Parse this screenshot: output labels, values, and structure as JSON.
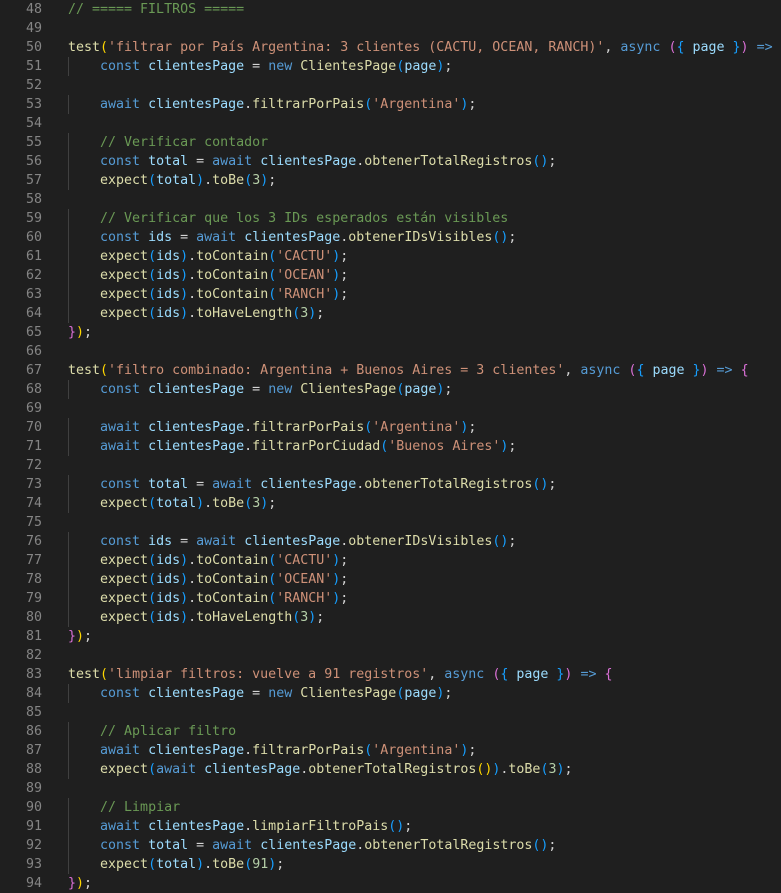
{
  "editor": {
    "first_line_number": 48,
    "lines": [
      [
        [
          "c",
          "// ===== FILTROS ====="
        ]
      ],
      [],
      [
        [
          "f",
          "test"
        ],
        [
          "b1",
          "("
        ],
        [
          "s",
          "'filtrar por País Argentina: 3 clientes (CACTU, OCEAN, RANCH)'"
        ],
        [
          "p",
          ", "
        ],
        [
          "k",
          "async"
        ],
        [
          "p",
          " "
        ],
        [
          "b2",
          "("
        ],
        [
          "b3",
          "{"
        ],
        [
          "v",
          " page "
        ],
        [
          "b3",
          "}"
        ],
        [
          "b2",
          ")"
        ],
        [
          "p",
          " "
        ],
        [
          "k",
          "=>"
        ],
        [
          "p",
          " "
        ],
        [
          "b2",
          "{"
        ]
      ],
      [
        [
          "p",
          "    "
        ],
        [
          "k",
          "const"
        ],
        [
          "p",
          " "
        ],
        [
          "v",
          "clientesPage"
        ],
        [
          "p",
          " = "
        ],
        [
          "k",
          "new"
        ],
        [
          "p",
          " "
        ],
        [
          "f",
          "ClientesPage"
        ],
        [
          "b3",
          "("
        ],
        [
          "v",
          "page"
        ],
        [
          "b3",
          ")"
        ],
        [
          "p",
          ";"
        ]
      ],
      [],
      [
        [
          "p",
          "    "
        ],
        [
          "k",
          "await"
        ],
        [
          "p",
          " "
        ],
        [
          "v",
          "clientesPage"
        ],
        [
          "p",
          "."
        ],
        [
          "f",
          "filtrarPorPais"
        ],
        [
          "b3",
          "("
        ],
        [
          "s",
          "'Argentina'"
        ],
        [
          "b3",
          ")"
        ],
        [
          "p",
          ";"
        ]
      ],
      [],
      [
        [
          "p",
          "    "
        ],
        [
          "c",
          "// Verificar contador"
        ]
      ],
      [
        [
          "p",
          "    "
        ],
        [
          "k",
          "const"
        ],
        [
          "p",
          " "
        ],
        [
          "v",
          "total"
        ],
        [
          "p",
          " = "
        ],
        [
          "k",
          "await"
        ],
        [
          "p",
          " "
        ],
        [
          "v",
          "clientesPage"
        ],
        [
          "p",
          "."
        ],
        [
          "f",
          "obtenerTotalRegistros"
        ],
        [
          "b3",
          "()"
        ],
        [
          "p",
          ";"
        ]
      ],
      [
        [
          "p",
          "    "
        ],
        [
          "f",
          "expect"
        ],
        [
          "b3",
          "("
        ],
        [
          "v",
          "total"
        ],
        [
          "b3",
          ")"
        ],
        [
          "p",
          "."
        ],
        [
          "f",
          "toBe"
        ],
        [
          "b3",
          "("
        ],
        [
          "n",
          "3"
        ],
        [
          "b3",
          ")"
        ],
        [
          "p",
          ";"
        ]
      ],
      [],
      [
        [
          "p",
          "    "
        ],
        [
          "c",
          "// Verificar que los 3 IDs esperados están visibles"
        ]
      ],
      [
        [
          "p",
          "    "
        ],
        [
          "k",
          "const"
        ],
        [
          "p",
          " "
        ],
        [
          "v",
          "ids"
        ],
        [
          "p",
          " = "
        ],
        [
          "k",
          "await"
        ],
        [
          "p",
          " "
        ],
        [
          "v",
          "clientesPage"
        ],
        [
          "p",
          "."
        ],
        [
          "f",
          "obtenerIDsVisibles"
        ],
        [
          "b3",
          "()"
        ],
        [
          "p",
          ";"
        ]
      ],
      [
        [
          "p",
          "    "
        ],
        [
          "f",
          "expect"
        ],
        [
          "b3",
          "("
        ],
        [
          "v",
          "ids"
        ],
        [
          "b3",
          ")"
        ],
        [
          "p",
          "."
        ],
        [
          "f",
          "toContain"
        ],
        [
          "b3",
          "("
        ],
        [
          "s",
          "'CACTU'"
        ],
        [
          "b3",
          ")"
        ],
        [
          "p",
          ";"
        ]
      ],
      [
        [
          "p",
          "    "
        ],
        [
          "f",
          "expect"
        ],
        [
          "b3",
          "("
        ],
        [
          "v",
          "ids"
        ],
        [
          "b3",
          ")"
        ],
        [
          "p",
          "."
        ],
        [
          "f",
          "toContain"
        ],
        [
          "b3",
          "("
        ],
        [
          "s",
          "'OCEAN'"
        ],
        [
          "b3",
          ")"
        ],
        [
          "p",
          ";"
        ]
      ],
      [
        [
          "p",
          "    "
        ],
        [
          "f",
          "expect"
        ],
        [
          "b3",
          "("
        ],
        [
          "v",
          "ids"
        ],
        [
          "b3",
          ")"
        ],
        [
          "p",
          "."
        ],
        [
          "f",
          "toContain"
        ],
        [
          "b3",
          "("
        ],
        [
          "s",
          "'RANCH'"
        ],
        [
          "b3",
          ")"
        ],
        [
          "p",
          ";"
        ]
      ],
      [
        [
          "p",
          "    "
        ],
        [
          "f",
          "expect"
        ],
        [
          "b3",
          "("
        ],
        [
          "v",
          "ids"
        ],
        [
          "b3",
          ")"
        ],
        [
          "p",
          "."
        ],
        [
          "f",
          "toHaveLength"
        ],
        [
          "b3",
          "("
        ],
        [
          "n",
          "3"
        ],
        [
          "b3",
          ")"
        ],
        [
          "p",
          ";"
        ]
      ],
      [
        [
          "b2",
          "}"
        ],
        [
          "b1",
          ")"
        ],
        [
          "p",
          ";"
        ]
      ],
      [],
      [
        [
          "f",
          "test"
        ],
        [
          "b1",
          "("
        ],
        [
          "s",
          "'filtro combinado: Argentina + Buenos Aires = 3 clientes'"
        ],
        [
          "p",
          ", "
        ],
        [
          "k",
          "async"
        ],
        [
          "p",
          " "
        ],
        [
          "b2",
          "("
        ],
        [
          "b3",
          "{"
        ],
        [
          "v",
          " page "
        ],
        [
          "b3",
          "}"
        ],
        [
          "b2",
          ")"
        ],
        [
          "p",
          " "
        ],
        [
          "k",
          "=>"
        ],
        [
          "p",
          " "
        ],
        [
          "b2",
          "{"
        ]
      ],
      [
        [
          "p",
          "    "
        ],
        [
          "k",
          "const"
        ],
        [
          "p",
          " "
        ],
        [
          "v",
          "clientesPage"
        ],
        [
          "p",
          " = "
        ],
        [
          "k",
          "new"
        ],
        [
          "p",
          " "
        ],
        [
          "f",
          "ClientesPage"
        ],
        [
          "b3",
          "("
        ],
        [
          "v",
          "page"
        ],
        [
          "b3",
          ")"
        ],
        [
          "p",
          ";"
        ]
      ],
      [],
      [
        [
          "p",
          "    "
        ],
        [
          "k",
          "await"
        ],
        [
          "p",
          " "
        ],
        [
          "v",
          "clientesPage"
        ],
        [
          "p",
          "."
        ],
        [
          "f",
          "filtrarPorPais"
        ],
        [
          "b3",
          "("
        ],
        [
          "s",
          "'Argentina'"
        ],
        [
          "b3",
          ")"
        ],
        [
          "p",
          ";"
        ]
      ],
      [
        [
          "p",
          "    "
        ],
        [
          "k",
          "await"
        ],
        [
          "p",
          " "
        ],
        [
          "v",
          "clientesPage"
        ],
        [
          "p",
          "."
        ],
        [
          "f",
          "filtrarPorCiudad"
        ],
        [
          "b3",
          "("
        ],
        [
          "s",
          "'Buenos Aires'"
        ],
        [
          "b3",
          ")"
        ],
        [
          "p",
          ";"
        ]
      ],
      [],
      [
        [
          "p",
          "    "
        ],
        [
          "k",
          "const"
        ],
        [
          "p",
          " "
        ],
        [
          "v",
          "total"
        ],
        [
          "p",
          " = "
        ],
        [
          "k",
          "await"
        ],
        [
          "p",
          " "
        ],
        [
          "v",
          "clientesPage"
        ],
        [
          "p",
          "."
        ],
        [
          "f",
          "obtenerTotalRegistros"
        ],
        [
          "b3",
          "()"
        ],
        [
          "p",
          ";"
        ]
      ],
      [
        [
          "p",
          "    "
        ],
        [
          "f",
          "expect"
        ],
        [
          "b3",
          "("
        ],
        [
          "v",
          "total"
        ],
        [
          "b3",
          ")"
        ],
        [
          "p",
          "."
        ],
        [
          "f",
          "toBe"
        ],
        [
          "b3",
          "("
        ],
        [
          "n",
          "3"
        ],
        [
          "b3",
          ")"
        ],
        [
          "p",
          ";"
        ]
      ],
      [],
      [
        [
          "p",
          "    "
        ],
        [
          "k",
          "const"
        ],
        [
          "p",
          " "
        ],
        [
          "v",
          "ids"
        ],
        [
          "p",
          " = "
        ],
        [
          "k",
          "await"
        ],
        [
          "p",
          " "
        ],
        [
          "v",
          "clientesPage"
        ],
        [
          "p",
          "."
        ],
        [
          "f",
          "obtenerIDsVisibles"
        ],
        [
          "b3",
          "()"
        ],
        [
          "p",
          ";"
        ]
      ],
      [
        [
          "p",
          "    "
        ],
        [
          "f",
          "expect"
        ],
        [
          "b3",
          "("
        ],
        [
          "v",
          "ids"
        ],
        [
          "b3",
          ")"
        ],
        [
          "p",
          "."
        ],
        [
          "f",
          "toContain"
        ],
        [
          "b3",
          "("
        ],
        [
          "s",
          "'CACTU'"
        ],
        [
          "b3",
          ")"
        ],
        [
          "p",
          ";"
        ]
      ],
      [
        [
          "p",
          "    "
        ],
        [
          "f",
          "expect"
        ],
        [
          "b3",
          "("
        ],
        [
          "v",
          "ids"
        ],
        [
          "b3",
          ")"
        ],
        [
          "p",
          "."
        ],
        [
          "f",
          "toContain"
        ],
        [
          "b3",
          "("
        ],
        [
          "s",
          "'OCEAN'"
        ],
        [
          "b3",
          ")"
        ],
        [
          "p",
          ";"
        ]
      ],
      [
        [
          "p",
          "    "
        ],
        [
          "f",
          "expect"
        ],
        [
          "b3",
          "("
        ],
        [
          "v",
          "ids"
        ],
        [
          "b3",
          ")"
        ],
        [
          "p",
          "."
        ],
        [
          "f",
          "toContain"
        ],
        [
          "b3",
          "("
        ],
        [
          "s",
          "'RANCH'"
        ],
        [
          "b3",
          ")"
        ],
        [
          "p",
          ";"
        ]
      ],
      [
        [
          "p",
          "    "
        ],
        [
          "f",
          "expect"
        ],
        [
          "b3",
          "("
        ],
        [
          "v",
          "ids"
        ],
        [
          "b3",
          ")"
        ],
        [
          "p",
          "."
        ],
        [
          "f",
          "toHaveLength"
        ],
        [
          "b3",
          "("
        ],
        [
          "n",
          "3"
        ],
        [
          "b3",
          ")"
        ],
        [
          "p",
          ";"
        ]
      ],
      [
        [
          "b2",
          "}"
        ],
        [
          "b1",
          ")"
        ],
        [
          "p",
          ";"
        ]
      ],
      [],
      [
        [
          "f",
          "test"
        ],
        [
          "b1",
          "("
        ],
        [
          "s",
          "'limpiar filtros: vuelve a 91 registros'"
        ],
        [
          "p",
          ", "
        ],
        [
          "k",
          "async"
        ],
        [
          "p",
          " "
        ],
        [
          "b2",
          "("
        ],
        [
          "b3",
          "{"
        ],
        [
          "v",
          " page "
        ],
        [
          "b3",
          "}"
        ],
        [
          "b2",
          ")"
        ],
        [
          "p",
          " "
        ],
        [
          "k",
          "=>"
        ],
        [
          "p",
          " "
        ],
        [
          "b2",
          "{"
        ]
      ],
      [
        [
          "p",
          "    "
        ],
        [
          "k",
          "const"
        ],
        [
          "p",
          " "
        ],
        [
          "v",
          "clientesPage"
        ],
        [
          "p",
          " = "
        ],
        [
          "k",
          "new"
        ],
        [
          "p",
          " "
        ],
        [
          "f",
          "ClientesPage"
        ],
        [
          "b3",
          "("
        ],
        [
          "v",
          "page"
        ],
        [
          "b3",
          ")"
        ],
        [
          "p",
          ";"
        ]
      ],
      [],
      [
        [
          "p",
          "    "
        ],
        [
          "c",
          "// Aplicar filtro"
        ]
      ],
      [
        [
          "p",
          "    "
        ],
        [
          "k",
          "await"
        ],
        [
          "p",
          " "
        ],
        [
          "v",
          "clientesPage"
        ],
        [
          "p",
          "."
        ],
        [
          "f",
          "filtrarPorPais"
        ],
        [
          "b3",
          "("
        ],
        [
          "s",
          "'Argentina'"
        ],
        [
          "b3",
          ")"
        ],
        [
          "p",
          ";"
        ]
      ],
      [
        [
          "p",
          "    "
        ],
        [
          "f",
          "expect"
        ],
        [
          "b3",
          "("
        ],
        [
          "k",
          "await"
        ],
        [
          "p",
          " "
        ],
        [
          "v",
          "clientesPage"
        ],
        [
          "p",
          "."
        ],
        [
          "f",
          "obtenerTotalRegistros"
        ],
        [
          "b1",
          "()"
        ],
        [
          "b3",
          ")"
        ],
        [
          "p",
          "."
        ],
        [
          "f",
          "toBe"
        ],
        [
          "b3",
          "("
        ],
        [
          "n",
          "3"
        ],
        [
          "b3",
          ")"
        ],
        [
          "p",
          ";"
        ]
      ],
      [],
      [
        [
          "p",
          "    "
        ],
        [
          "c",
          "// Limpiar"
        ]
      ],
      [
        [
          "p",
          "    "
        ],
        [
          "k",
          "await"
        ],
        [
          "p",
          " "
        ],
        [
          "v",
          "clientesPage"
        ],
        [
          "p",
          "."
        ],
        [
          "f",
          "limpiarFiltroPais"
        ],
        [
          "b3",
          "()"
        ],
        [
          "p",
          ";"
        ]
      ],
      [
        [
          "p",
          "    "
        ],
        [
          "k",
          "const"
        ],
        [
          "p",
          " "
        ],
        [
          "v",
          "total"
        ],
        [
          "p",
          " = "
        ],
        [
          "k",
          "await"
        ],
        [
          "p",
          " "
        ],
        [
          "v",
          "clientesPage"
        ],
        [
          "p",
          "."
        ],
        [
          "f",
          "obtenerTotalRegistros"
        ],
        [
          "b3",
          "()"
        ],
        [
          "p",
          ";"
        ]
      ],
      [
        [
          "p",
          "    "
        ],
        [
          "f",
          "expect"
        ],
        [
          "b3",
          "("
        ],
        [
          "v",
          "total"
        ],
        [
          "b3",
          ")"
        ],
        [
          "p",
          "."
        ],
        [
          "f",
          "toBe"
        ],
        [
          "b3",
          "("
        ],
        [
          "n",
          "91"
        ],
        [
          "b3",
          ")"
        ],
        [
          "p",
          ";"
        ]
      ],
      [
        [
          "b2",
          "}"
        ],
        [
          "b1",
          ")"
        ],
        [
          "p",
          ";"
        ]
      ]
    ]
  }
}
